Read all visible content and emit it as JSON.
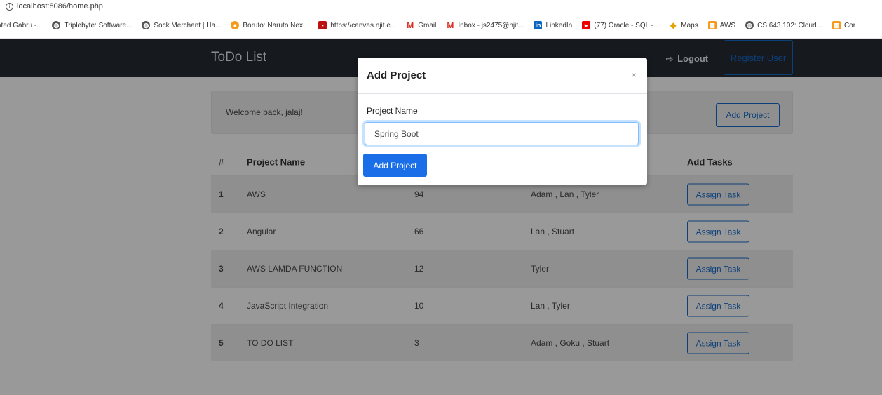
{
  "browser": {
    "url": "localhost:8086/home.php",
    "bookmarks": [
      {
        "label": "ated Gabru -...",
        "icon": "none"
      },
      {
        "label": "Triplebyte: Software...",
        "icon": "globe-icon"
      },
      {
        "label": "Sock Merchant | Ha...",
        "icon": "globe-icon"
      },
      {
        "label": "Boruto: Naruto Nex...",
        "icon": "boruto-icon"
      },
      {
        "label": "https://canvas.njit.e...",
        "icon": "canvas-icon"
      },
      {
        "label": "Gmail",
        "icon": "gmail-icon"
      },
      {
        "label": "Inbox - js2475@njit...",
        "icon": "gmail-icon"
      },
      {
        "label": "LinkedIn",
        "icon": "linkedin-icon"
      },
      {
        "label": "(77) Oracle - SQL -...",
        "icon": "youtube-icon"
      },
      {
        "label": "Maps",
        "icon": "maps-icon"
      },
      {
        "label": "AWS",
        "icon": "aws-icon"
      },
      {
        "label": "CS 643 102: Cloud...",
        "icon": "globe-icon"
      },
      {
        "label": "Cor",
        "icon": "aws-icon"
      }
    ]
  },
  "navbar": {
    "brand": "ToDo List",
    "logout": "Logout",
    "register": "Register User"
  },
  "welcome": {
    "text": "Welcome back, jalaj!",
    "add_project": "Add Project"
  },
  "table": {
    "headers": {
      "num": "#",
      "name": "Project Name",
      "tasks": "Add Tasks"
    },
    "rows": [
      {
        "num": "1",
        "name": "AWS",
        "count": "94",
        "members": "Adam , Lan , Tyler",
        "action": "Assign Task"
      },
      {
        "num": "2",
        "name": "Angular",
        "count": "66",
        "members": "Lan , Stuart",
        "action": "Assign Task"
      },
      {
        "num": "3",
        "name": "AWS LAMDA FUNCTION",
        "count": "12",
        "members": "Tyler",
        "action": "Assign Task"
      },
      {
        "num": "4",
        "name": "JavaScript Integration",
        "count": "10",
        "members": "Lan , Tyler",
        "action": "Assign Task"
      },
      {
        "num": "5",
        "name": "TO DO LIST",
        "count": "3",
        "members": "Adam , Goku , Stuart",
        "action": "Assign Task"
      }
    ]
  },
  "modal": {
    "title": "Add Project",
    "close": "×",
    "label": "Project Name",
    "input_value": "Spring Boot",
    "submit": "Add Project"
  },
  "colors": {
    "navbar": "#161a1e",
    "primary": "#1a6fe8",
    "overlay": "#999999"
  }
}
